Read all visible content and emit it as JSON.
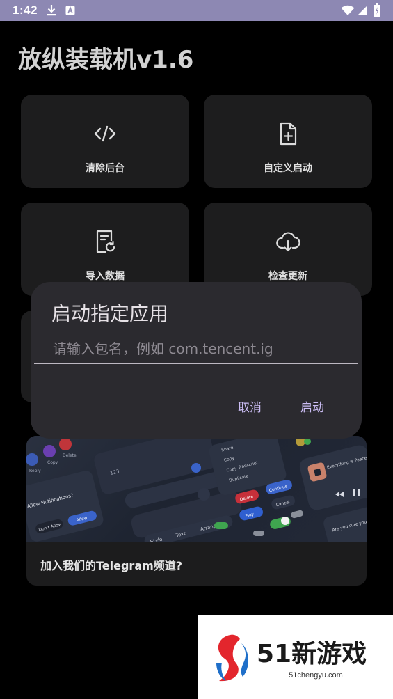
{
  "status_bar": {
    "time": "1:42",
    "icons": [
      "download-icon",
      "app-notification-icon",
      "wifi-icon",
      "signal-icon",
      "battery-icon"
    ],
    "background_color": "#8d88b3"
  },
  "app": {
    "title": "放纵装载机v1.6"
  },
  "tiles": [
    {
      "label": "清除后台",
      "icon": "code-icon"
    },
    {
      "label": "自定义启动",
      "icon": "file-add-icon"
    },
    {
      "label": "导入数据",
      "icon": "document-refresh-icon"
    },
    {
      "label": "检查更新",
      "icon": "cloud-download-icon"
    }
  ],
  "dialog": {
    "title": "启动指定应用",
    "input_placeholder": "请输入包名，例如 com.tencent.ig",
    "input_value": "",
    "cancel_label": "取消",
    "confirm_label": "启动",
    "accent_color": "#cbbdf4"
  },
  "telegram_card": {
    "caption": "加入我们的Telegram频道?",
    "banner_text": {
      "notification_title": "Allow Notifications?",
      "dont_allow": "Don't Allow",
      "allow": "Allow",
      "menu_share": "Share",
      "menu_copy": "Copy",
      "menu_copy_transcript": "Copy Transcript",
      "menu_duplicate": "Duplicate",
      "delete": "Delete",
      "continue": "Continue",
      "play": "Play",
      "cancel": "Cancel",
      "song": "Everything is Peaceful",
      "confirm_question": "Are you sure you want to delete this event?",
      "style": "Style",
      "text": "Text",
      "arrange": "Arrange",
      "value": "123"
    }
  },
  "watermark": {
    "text": "51新游戏",
    "url": "51chengyu.com"
  }
}
